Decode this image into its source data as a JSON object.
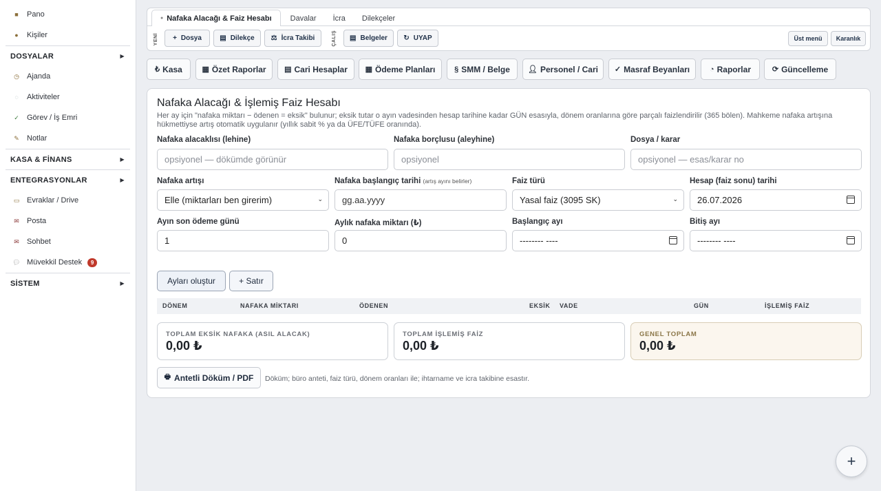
{
  "sidebar": {
    "pano": "Pano",
    "kisiler": "Kişiler",
    "dosyalar": "DOSYALAR",
    "ajanda": "Ajanda",
    "aktiviteler": "Aktiviteler",
    "gorev": "Görev / İş Emri",
    "notlar": "Notlar",
    "kasa": "KASA & FİNANS",
    "entegrasyonlar": "ENTEGRASYONLAR",
    "evraklar": "Evraklar / Drive",
    "posta": "Posta",
    "sohbet": "Sohbet",
    "muvekkil": "Müvekkil Destek",
    "muvekkil_badge": "9",
    "sistem": "SİSTEM"
  },
  "tabs": {
    "active": "Nafaka Alacağı & Faiz Hesabı",
    "davalar": "Davalar",
    "icra": "İcra",
    "dilekceler": "Dilekçeler"
  },
  "toolbar": {
    "yeni_label": "YENİ",
    "calis_label": "ÇALIŞ",
    "dosya": "Dosya",
    "dilekce": "Dilekçe",
    "icra_takibi": "İcra Takibi",
    "belgeler": "Belgeler",
    "uyap": "UYAP",
    "ust_menu": "Üst menü",
    "karanlik": "Karanlık"
  },
  "modules": {
    "kasa": "Kasa",
    "ozet_raporlar": "Özet Raporlar",
    "cari_hesaplar": "Cari Hesaplar",
    "odeme_planlari": "Ödeme Planları",
    "smm_belge": "SMM / Belge",
    "personel_cari": "Personel / Cari",
    "masraf_beyanlari": "Masraf Beyanları",
    "raporlar": "Raporlar",
    "guncelleme": "Güncelleme"
  },
  "form": {
    "title": "Nafaka Alacağı & İşlemiş Faiz Hesabı",
    "description": "Her ay için \"nafaka miktarı − ödenen = eksik\" bulunur; eksik tutar o ayın vadesinden hesap tarihine kadar GÜN esasıyla, dönem oranlarına göre parçalı faizlendirilir (365 bölen). Mahkeme nafaka artışına hükmettiyse artış otomatik uygulanır (yıllık sabit % ya da ÜFE/TÜFE oranında).",
    "alacakli_label": "Nafaka alacaklısı (lehine)",
    "alacakli_placeholder": "opsiyonel — dökümde görünür",
    "borclu_label": "Nafaka borçlusu (aleyhine)",
    "borclu_placeholder": "opsiyonel",
    "dosya_label": "Dosya / karar",
    "dosya_placeholder": "opsiyonel — esas/karar no",
    "artis_label": "Nafaka artışı",
    "artis_value": "Elle (miktarları ben girerim)",
    "baslangic_tarihi_label": "Nafaka başlangıç tarihi",
    "baslangic_tarihi_hint": "(artış ayını belirler)",
    "baslangic_tarihi_placeholder": "gg.aa.yyyy",
    "faiz_turu_label": "Faiz türü",
    "faiz_turu_value": "Yasal faiz (3095 SK)",
    "hesap_tarihi_label": "Hesap (faiz sonu) tarihi",
    "hesap_tarihi_value": "26.07.2026",
    "son_odeme_label": "Ayın son ödeme günü",
    "son_odeme_value": "1",
    "aylik_miktar_label": "Aylık nafaka miktarı (₺)",
    "aylik_miktar_value": "0",
    "baslangic_ay_label": "Başlangıç ayı",
    "baslangic_ay_value": "-------- ----",
    "bitis_ay_label": "Bitiş ayı",
    "bitis_ay_value": "-------- ----",
    "aylari_olustur": "Ayları oluştur",
    "satir": "+ Satır"
  },
  "table": {
    "columns": [
      "DÖNEM",
      "NAFAKA MİKTARI",
      "ÖDENEN",
      "EKSİK",
      "VADE",
      "GÜN",
      "İŞLEMİŞ FAİZ"
    ]
  },
  "summary": {
    "eksik_label": "TOPLAM EKSİK NAFAKA (ASIL ALACAK)",
    "eksik_value": "0,00 ₺",
    "faiz_label": "TOPLAM İŞLEMİŞ FAİZ",
    "faiz_value": "0,00 ₺",
    "genel_label": "GENEL TOPLAM",
    "genel_value": "0,00 ₺"
  },
  "footer": {
    "pdf_button": "Antetli Döküm / PDF",
    "note": "Döküm; büro anteti, faiz türü, dönem oranları ile; ihtarname ve icra takibine esastır."
  },
  "fab": "+",
  "colors": {
    "accent": "#1e2a3c",
    "badge": "#c0392b",
    "highlight_bg": "#fbf6ee"
  }
}
